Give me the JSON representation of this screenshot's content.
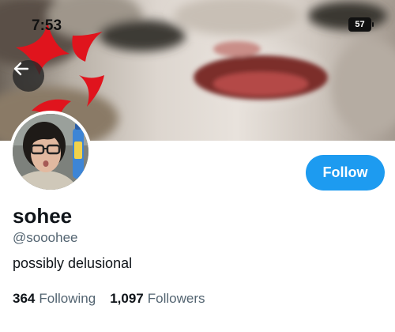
{
  "status_bar": {
    "time": "7:53",
    "battery": "57"
  },
  "header": {
    "back_icon": "arrow-left-icon",
    "anger_icon": "anger-symbol-icon"
  },
  "profile": {
    "display_name": "sohee",
    "handle": "@sooohee",
    "bio": "possibly delusional",
    "follow_label": "Follow",
    "following_count": "364",
    "following_label": "Following",
    "followers_count": "1,097",
    "followers_label": "Followers"
  },
  "colors": {
    "accent": "#1d9bf0",
    "anger_red": "#e0141d",
    "text_primary": "#0f1419",
    "text_secondary": "#536471"
  }
}
